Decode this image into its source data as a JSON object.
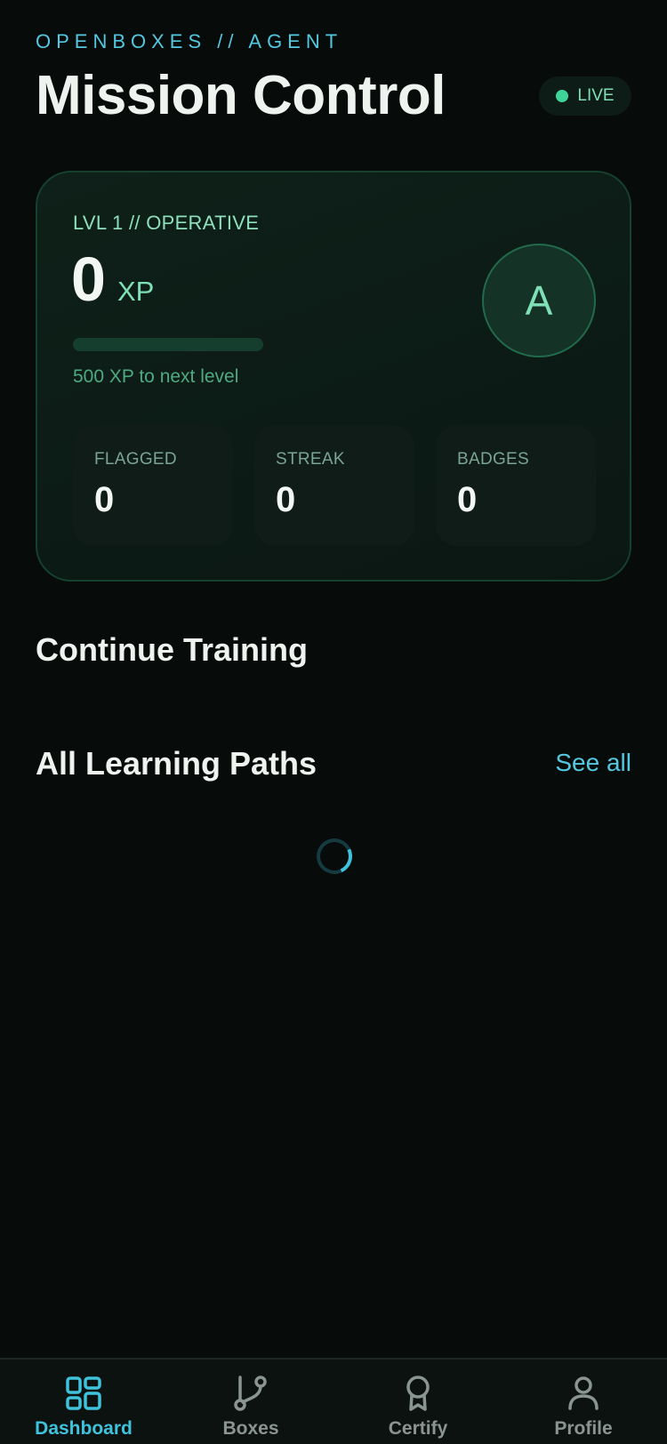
{
  "header": {
    "eyebrow": "OPENBOXES // AGENT",
    "title": "Mission Control",
    "status": "LIVE"
  },
  "xp_card": {
    "level_label": "LVL 1 // OPERATIVE",
    "xp_value": "0",
    "xp_unit": "XP",
    "progress_fraction": 0,
    "next_level_text": "500 XP to next level",
    "avatar_initial": "A",
    "stats": [
      {
        "label": "FLAGGED",
        "value": "0"
      },
      {
        "label": "STREAK",
        "value": "0"
      },
      {
        "label": "BADGES",
        "value": "0"
      }
    ]
  },
  "sections": {
    "continue_training": "Continue Training",
    "learning_paths": "All Learning Paths",
    "see_all": "See all"
  },
  "tabbar": {
    "tabs": [
      {
        "label": "Dashboard",
        "icon": "grid-icon",
        "active": true
      },
      {
        "label": "Boxes",
        "icon": "branch-icon",
        "active": false
      },
      {
        "label": "Certify",
        "icon": "award-icon",
        "active": false
      },
      {
        "label": "Profile",
        "icon": "user-icon",
        "active": false
      }
    ]
  },
  "colors": {
    "background": "#070b0a",
    "accent_green": "#3fd39a",
    "accent_cyan": "#3fc3dc"
  }
}
